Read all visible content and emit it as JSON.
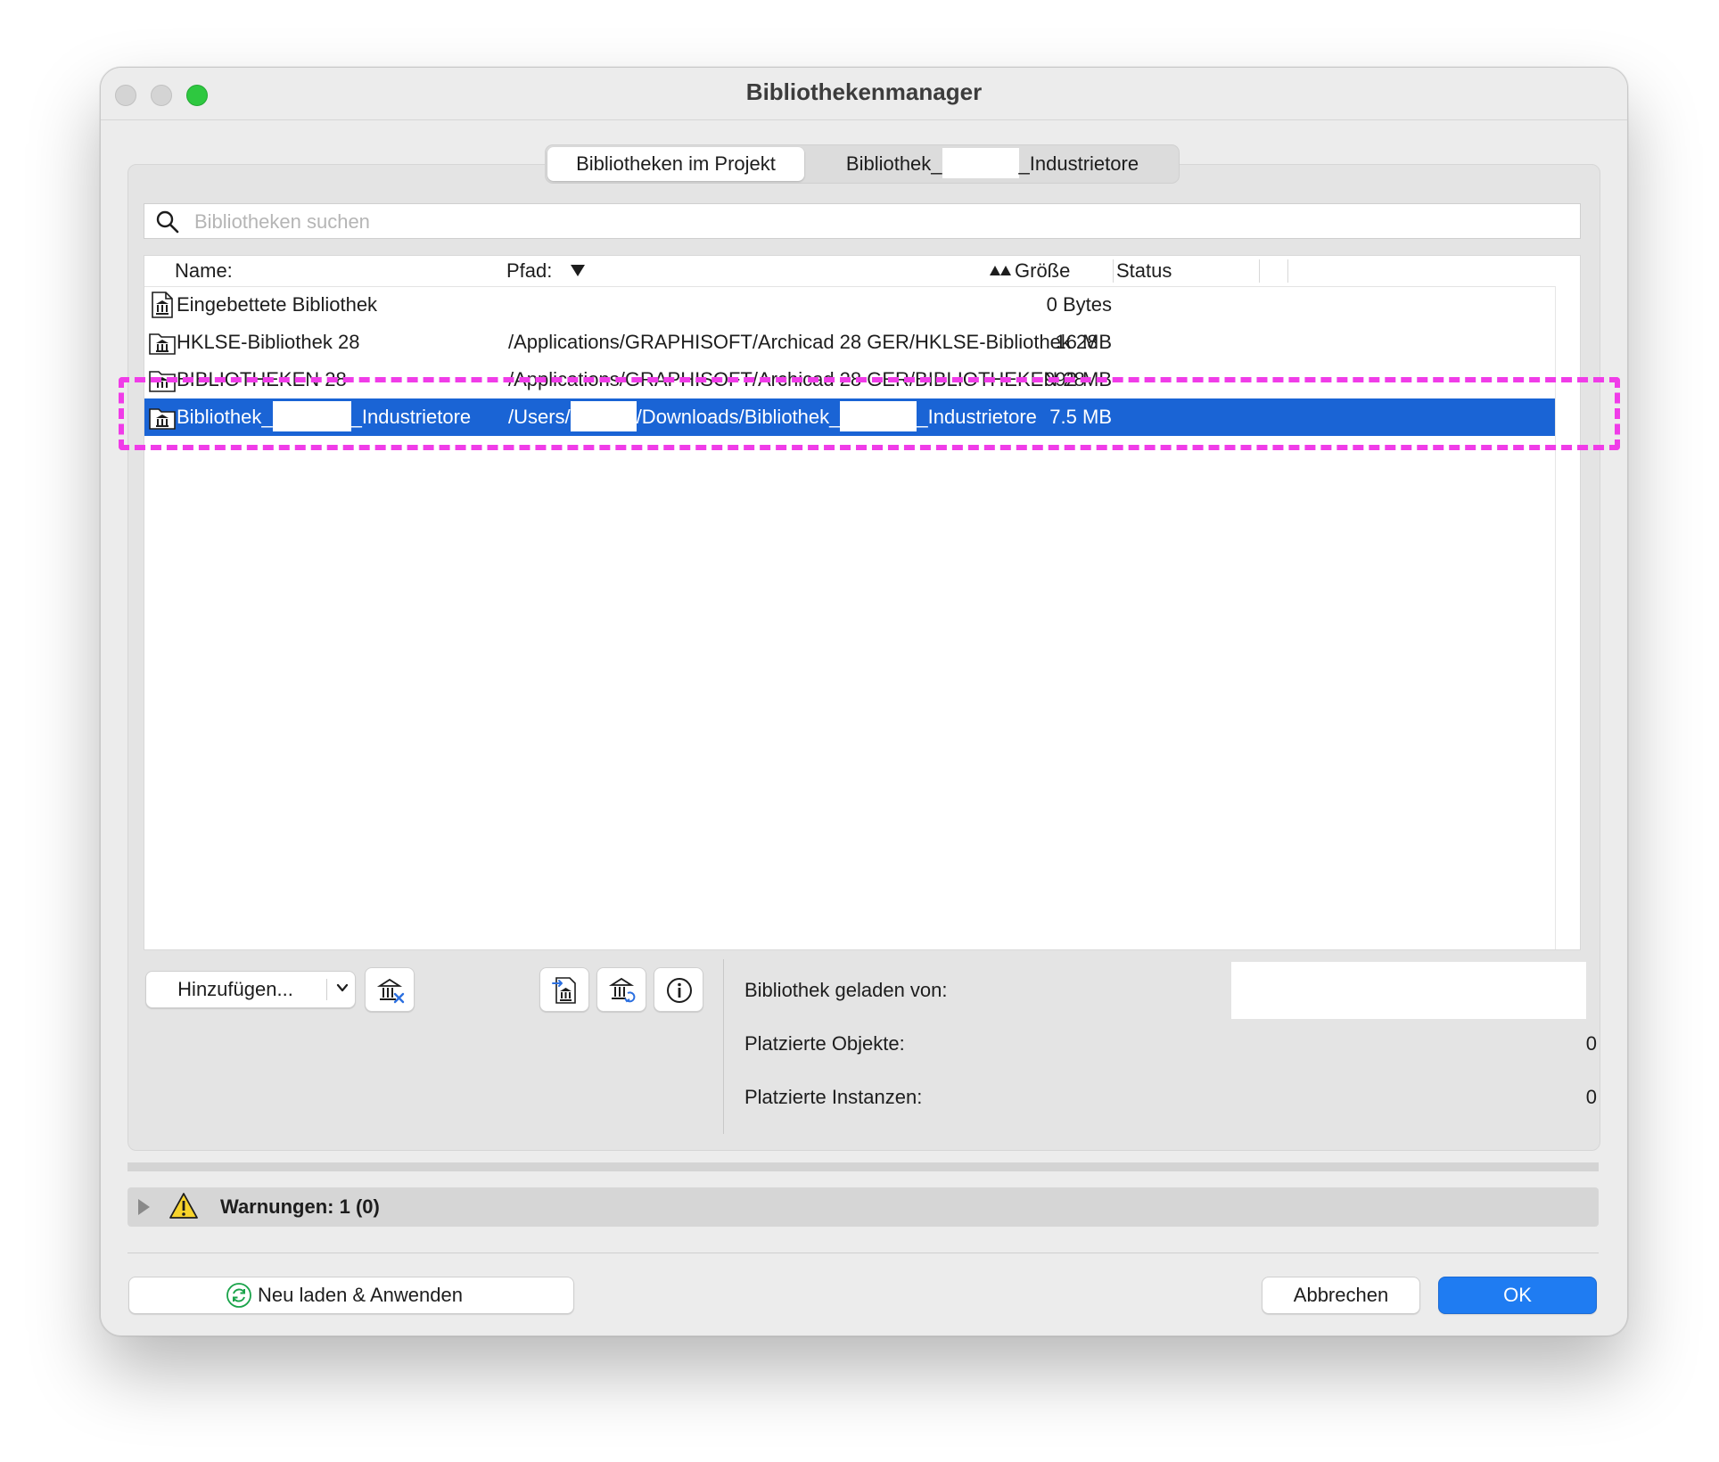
{
  "window": {
    "title": "Bibliothekenmanager"
  },
  "tabs": [
    {
      "label": "Bibliotheken im Projekt",
      "active": true
    },
    {
      "label_prefix": "Bibliothek_",
      "label_suffix": "_Industrietore",
      "active": false
    }
  ],
  "search": {
    "placeholder": "Bibliotheken suchen",
    "value": ""
  },
  "table": {
    "columns": {
      "name": "Name:",
      "path": "Pfad:",
      "size": "Größe",
      "status": "Status"
    },
    "rows": [
      {
        "name": "Eingebettete Bibliothek",
        "path": "",
        "size": "0 Bytes",
        "status": "",
        "icon": "embedded-library-icon"
      },
      {
        "name": "HKLSE-Bibliothek 28",
        "path": "/Applications/GRAPHISOFT/Archicad 28 GER/HKLSE-Bibliothek 28",
        "size": "16 MB",
        "status": "",
        "icon": "library-folder-icon"
      },
      {
        "name": "BIBLIOTHEKEN 28",
        "path": "/Applications/GRAPHISOFT/Archicad 28 GER/BIBLIOTHEKEN 28",
        "size": "992 MB",
        "status": "",
        "icon": "library-folder-icon"
      },
      {
        "name_prefix": "Bibliothek_",
        "name_suffix": "_Industrietore",
        "path_a": "/Users/",
        "path_b": "/Downloads/Bibliothek_",
        "path_c": "_Industrietore",
        "size": "7.5 MB",
        "status": "",
        "icon": "library-folder-icon",
        "selected": true
      }
    ]
  },
  "toolbar": {
    "add_label": "Hinzufügen..."
  },
  "info": {
    "loaded_from_label": "Bibliothek geladen von:",
    "placed_objects_label": "Platzierte Objekte:",
    "placed_objects_value": "0",
    "placed_instances_label": "Platzierte Instanzen:",
    "placed_instances_value": "0"
  },
  "warnings": {
    "label": "Warnungen: 1 (0)"
  },
  "footer": {
    "reload_label": "Neu laden & Anwenden",
    "cancel_label": "Abbrechen",
    "ok_label": "OK"
  },
  "colors": {
    "selection": "#1a64d5",
    "ok_button": "#1f7cf2",
    "highlight": "#f03ce8",
    "traffic_green": "#2ec840"
  }
}
